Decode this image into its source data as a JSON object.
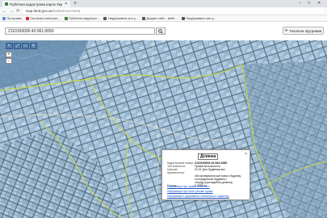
{
  "browser": {
    "tab_title": "Публічна кадастрова карта Укр",
    "new_tab": "+",
    "win_min": "–",
    "win_max": "□",
    "win_close": "✕",
    "nav_back": "←",
    "nav_forward": "→",
    "nav_reload": "⟳",
    "url_host": "map.land.gov.ua",
    "url_path": "/kadastrova-karta",
    "bookmarks": [
      "Програми",
      "Система електрон...",
      "Публічна кадастро...",
      "Недержавна сил у...",
      "Додати сайт - вебп...",
      "Недержавна сил у..."
    ]
  },
  "app": {
    "search_value": "2110100000:42:061:0050",
    "search_icon": "search-icon",
    "tech_button_label": "Технічна підтримка"
  },
  "map_tools": {
    "tools": [
      "↖",
      "⤢",
      "▭",
      "⚲"
    ],
    "zoom_in": "+",
    "zoom_out": "−"
  },
  "popup": {
    "title": "Ділянка",
    "close": "×",
    "rows": [
      {
        "k": "Кадастровий номер:",
        "v": "2110100000:42:061:0050",
        "bold": true
      },
      {
        "k": "Тип власності:",
        "v": "Приватна власність",
        "bold": false
      },
      {
        "k": "Цільове призначення:",
        "v": "02.01 Для будівництва і",
        "bold": false
      },
      {
        "k": "",
        "v": "обслуговування житлового будинку, господарських будівель і",
        "bold": false
      },
      {
        "k": "",
        "v": "споруд (присадибна ділянка)",
        "bold": false
      },
      {
        "k": "Площа:",
        "v": "0.0586 га",
        "bold": false
      }
    ],
    "links": [
      "Інформація про право власності",
      "Інформація про інше речове право",
      "Інформація з Державного земельного кадастру"
    ]
  },
  "colors": {
    "parcel_outline": "#8fb7dc",
    "parcel_fill": "#b8d4ee",
    "boundary": "#c9d74a",
    "link": "#1a56c4"
  }
}
